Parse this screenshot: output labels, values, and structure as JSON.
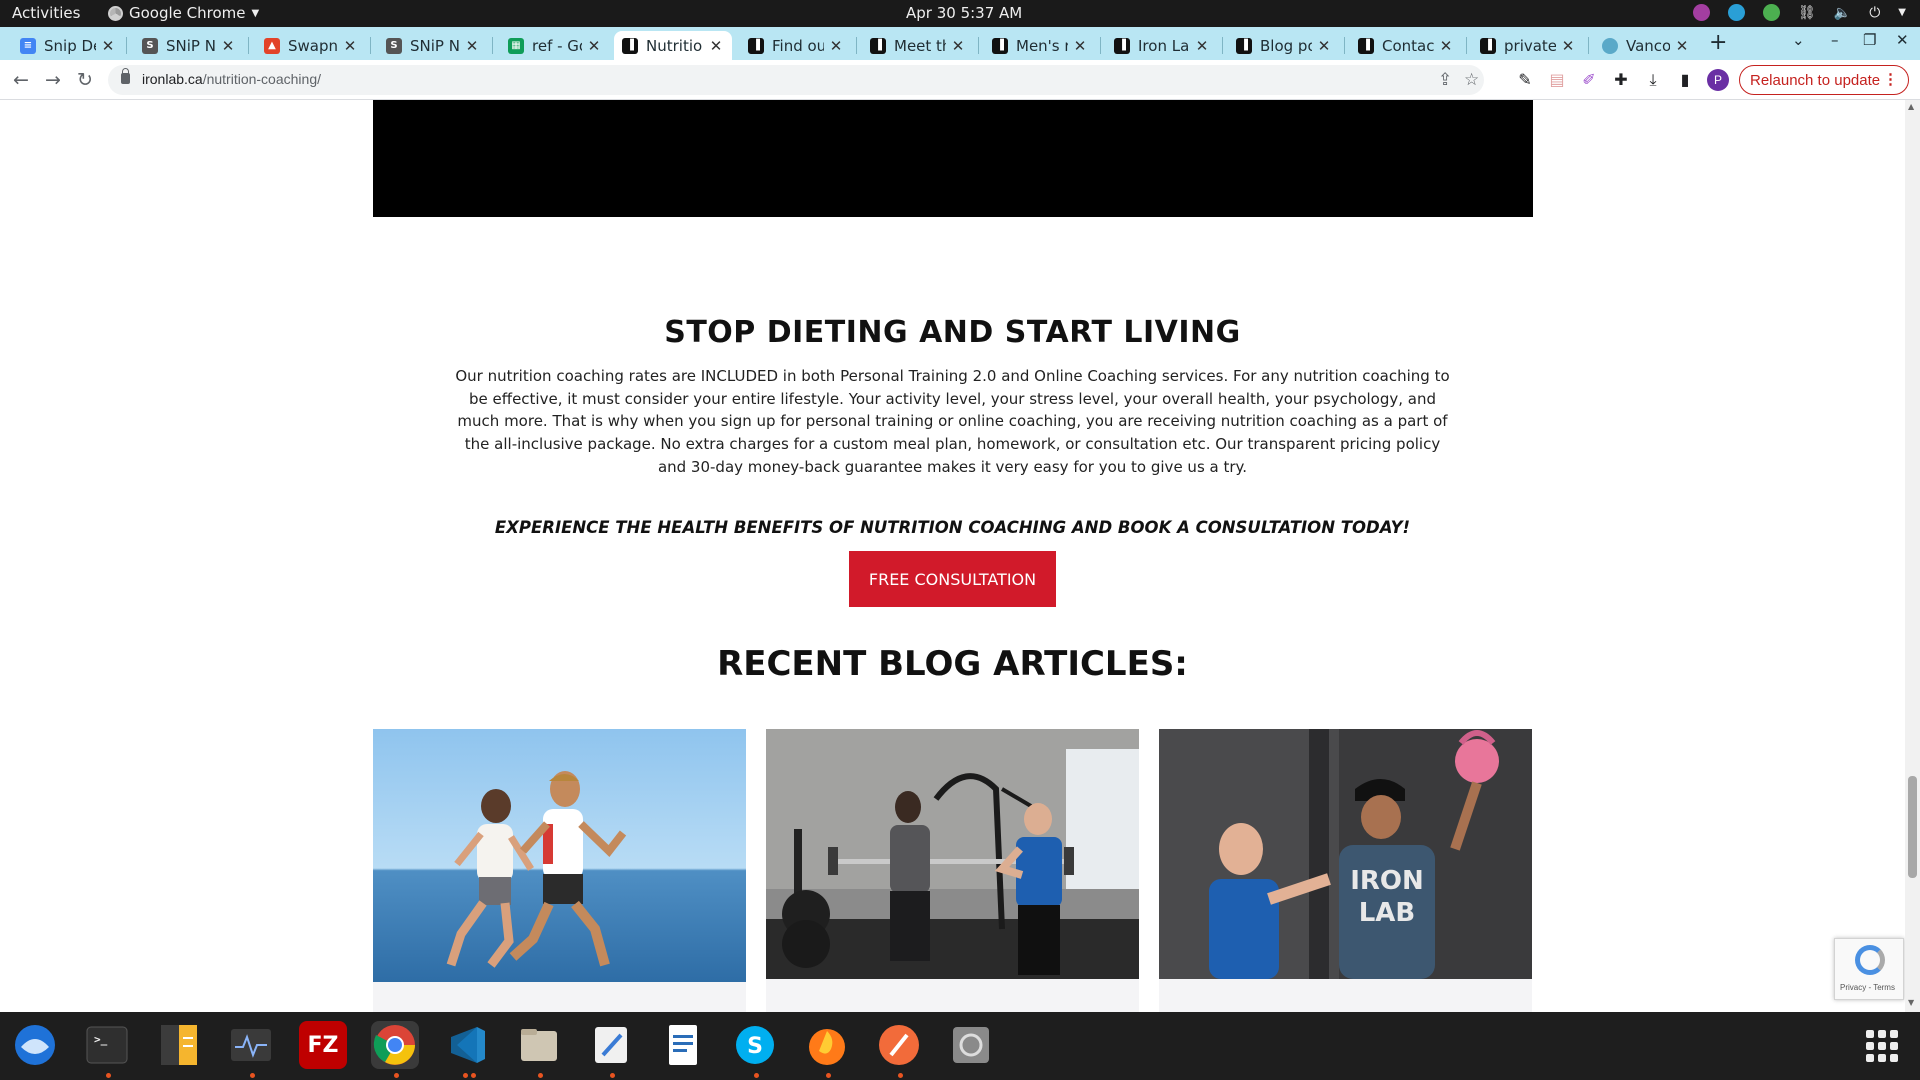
{
  "system": {
    "activities": "Activities",
    "app_menu": "Google Chrome",
    "clock": "Apr 30  5:37 AM"
  },
  "tabs": [
    {
      "title": "Snip Det",
      "icon": "docs-icon",
      "color": "#4285f4"
    },
    {
      "title": "SNiP Nu",
      "icon": "snip-icon",
      "color": "#555555"
    },
    {
      "title": "Swapnil",
      "icon": "gitlab-icon",
      "color": "#e24329"
    },
    {
      "title": "SNiP Nu",
      "icon": "snip-icon",
      "color": "#555555"
    },
    {
      "title": "ref - Goo",
      "icon": "sheets-icon",
      "color": "#0f9d58"
    },
    {
      "title": "Nutritio",
      "icon": "ironlab-icon",
      "color": "#111111",
      "active": true
    },
    {
      "title": "Find out",
      "icon": "ironlab-icon",
      "color": "#111111"
    },
    {
      "title": "Meet th",
      "icon": "ironlab-icon",
      "color": "#111111"
    },
    {
      "title": "Men's re",
      "icon": "ironlab-icon",
      "color": "#111111"
    },
    {
      "title": "Iron Lab",
      "icon": "ironlab-icon",
      "color": "#111111"
    },
    {
      "title": "Blog po",
      "icon": "ironlab-icon",
      "color": "#111111"
    },
    {
      "title": "Contact",
      "icon": "ironlab-icon",
      "color": "#111111"
    },
    {
      "title": "private",
      "icon": "ironlab-icon",
      "color": "#111111"
    },
    {
      "title": "Vancou",
      "icon": "globe-icon",
      "color": "#5aa9c8"
    }
  ],
  "toolbar": {
    "url_host": "ironlab.ca",
    "url_path": "/nutrition-coaching/",
    "profile_initial": "P",
    "relaunch_label": "Relaunch to update"
  },
  "page": {
    "heading": "STOP DIETING AND START LIVING",
    "paragraph": "Our nutrition coaching rates are INCLUDED in both Personal Training 2.0 and Online Coaching services. For any nutrition coaching to be effective, it must consider your entire lifestyle. Your activity level, your stress level, your overall health, your psychology, and much more. That is why when you sign up for personal training or online coaching, you are receiving nutrition coaching as a part of the all-inclusive package. No extra charges for a custom meal plan, homework, or consultation etc. Our transparent pricing policy and 30-day money-back guarantee makes it very easy for you to give us a try.",
    "cta_text": "EXPERIENCE THE HEALTH BENEFITS OF NUTRITION COACHING AND BOOK A CONSULTATION TODAY!",
    "cta_button": "FREE CONSULTATION",
    "blog_heading": "RECENT BLOG ARTICLES:",
    "shirt_text_1": "IRON",
    "shirt_text_2": "LAB",
    "recaptcha_terms": "Privacy - Terms",
    "accent_color": "#d11a2a"
  },
  "dock": [
    {
      "name": "thunderbird-icon"
    },
    {
      "name": "terminal-icon"
    },
    {
      "name": "notes-icon"
    },
    {
      "name": "system-monitor-icon"
    },
    {
      "name": "filezilla-icon",
      "label": "FZ"
    },
    {
      "name": "chrome-icon"
    },
    {
      "name": "vscode-icon"
    },
    {
      "name": "files-icon"
    },
    {
      "name": "text-editor-icon"
    },
    {
      "name": "writer-icon"
    },
    {
      "name": "skype-icon",
      "label": "S"
    },
    {
      "name": "firefox-icon"
    },
    {
      "name": "pen-tool-icon"
    },
    {
      "name": "disk-icon"
    }
  ]
}
